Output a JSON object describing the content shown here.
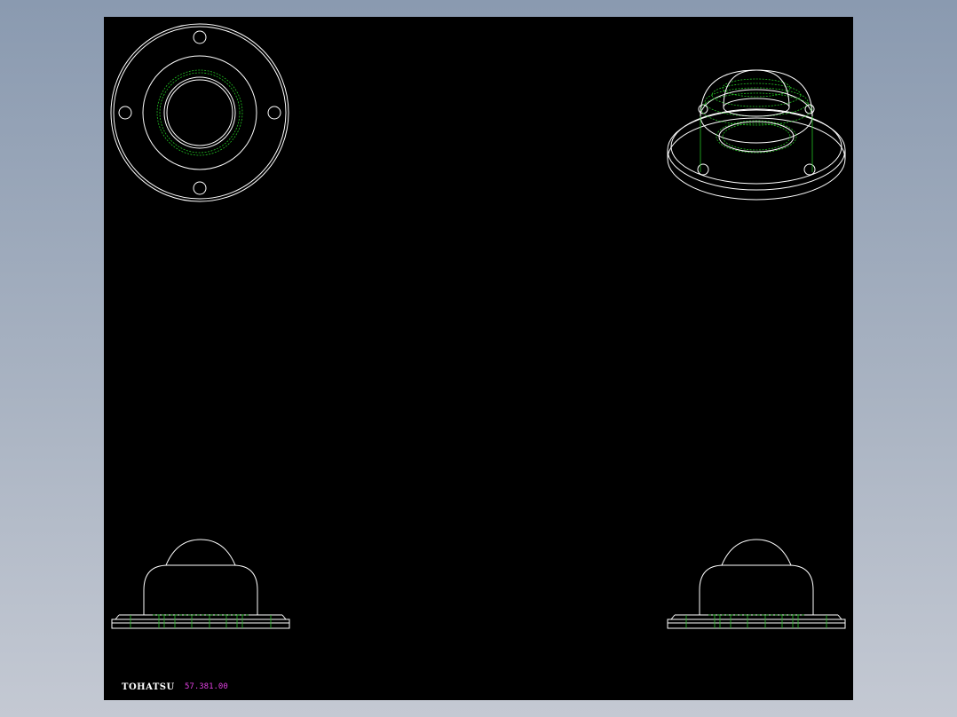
{
  "sheet": {
    "background": "#000000",
    "line_color": "#ffffff",
    "hidden_line_color": "#22c022"
  },
  "title_block": {
    "brand": "TOHATSU",
    "part_number": "57.381.00",
    "brand_color": "#ffffff",
    "part_number_color": "#e040e0"
  },
  "views": [
    "top-view",
    "isometric-view",
    "front-view",
    "side-view"
  ]
}
